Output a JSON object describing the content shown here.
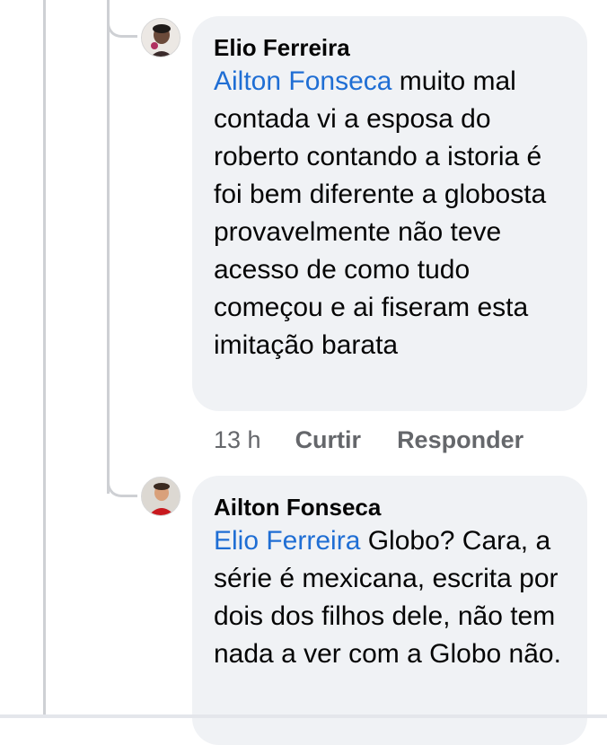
{
  "comments": [
    {
      "author": "Elio Ferreira",
      "mention": "Ailton Fonseca",
      "text": " muito mal contada vi a esposa do roberto contando a istoria é foi bem diferente a globosta provavelmente não teve acesso de como tudo começou e ai fiseram esta imitação barata",
      "time": "13 h",
      "like_label": "Curtir",
      "reply_label": "Responder"
    },
    {
      "author": "Ailton Fonseca",
      "mention": "Elio Ferreira",
      "text": " Globo? Cara, a série é mexicana, escrita por dois dos filhos dele, não tem nada a ver com a Globo não."
    }
  ],
  "colors": {
    "mention": "#1f6ed4",
    "bubble": "#f0f2f5",
    "thread_line": "#ced0d4",
    "meta_text": "#65676b"
  }
}
